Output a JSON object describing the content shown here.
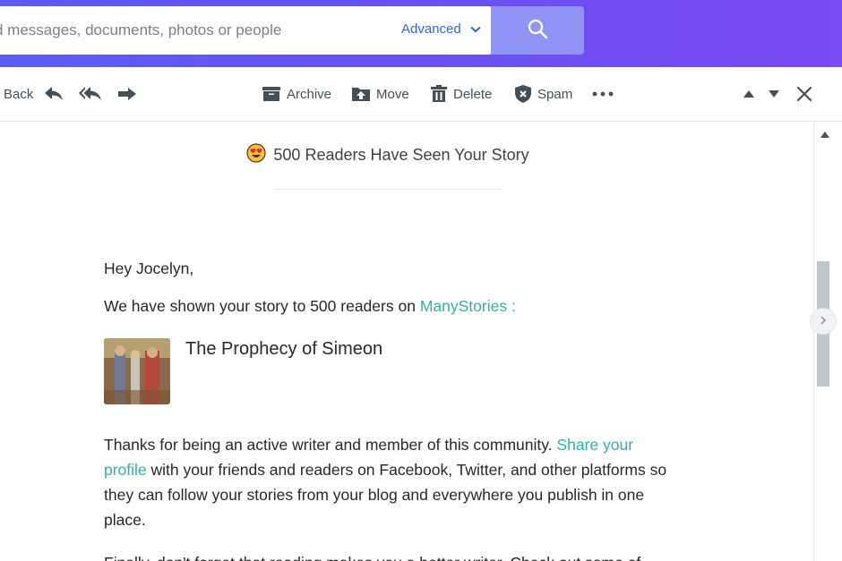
{
  "search": {
    "placeholder": "d messages, documents, photos or people",
    "advanced_label": "Advanced",
    "search_icon": "search-icon"
  },
  "toolbar": {
    "back_label": "Back",
    "archive_label": "Archive",
    "move_label": "Move",
    "delete_label": "Delete",
    "spam_label": "Spam",
    "icons": [
      "reply-icon",
      "reply-all-icon",
      "forward-icon",
      "more-icon",
      "up-arrow-icon",
      "down-arrow-icon",
      "close-icon"
    ]
  },
  "message": {
    "subject": "500 Readers Have Seen Your Story",
    "subject_emoji": "heart-eyes-emoji",
    "greeting": "Hey Jocelyn,",
    "shown_text": "We have shown your story to 500 readers on",
    "site_link": "ManyStories",
    "shown_suffix": " :",
    "story_title": "The Prophecy of Simeon",
    "thanks_text": "Thanks for being an active writer and member of this community.",
    "share_link": "Share your profile",
    "thanks_rest": " with your friends and readers on Facebook, Twitter, and other platforms so they can follow your stories from your blog and everywhere you publish in one place.",
    "cutoff_text": "Finally, don't forget that reading makes you a better writer. Check out some of"
  },
  "colors": {
    "header_start": "#5b5cf0",
    "header_end": "#7a4af2",
    "search_button": "#8f94f5",
    "advanced": "#2e64e6",
    "link": "#2eb3a0"
  }
}
